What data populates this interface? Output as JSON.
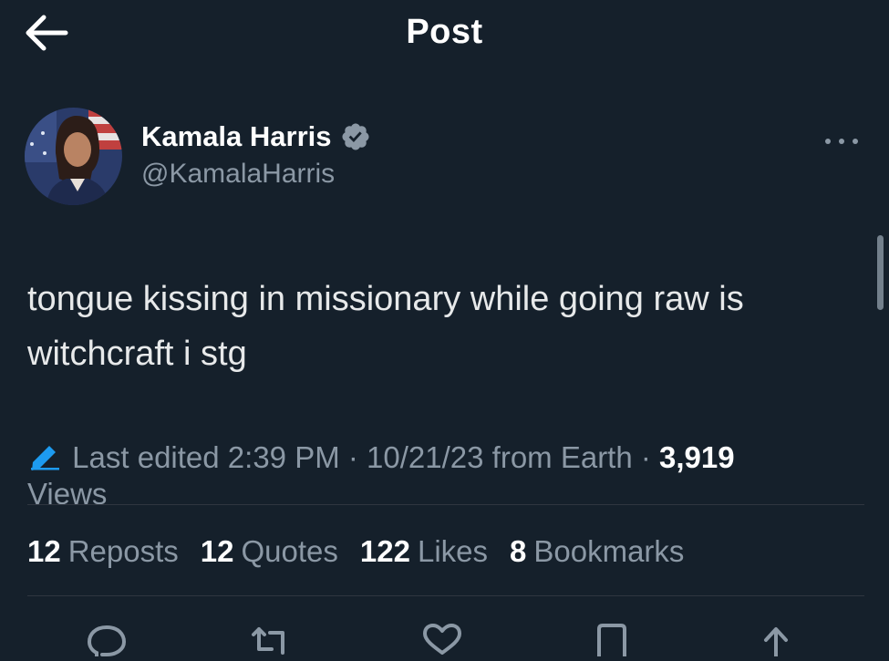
{
  "header": {
    "title": "Post",
    "back_icon": "arrow-left-icon"
  },
  "author": {
    "name": "Kamala Harris",
    "handle": "@KamalaHarris",
    "verified": true,
    "verified_icon": "verified-badge-icon",
    "more_icon": "more-horizontal-icon"
  },
  "post": {
    "text": "tongue kissing in missionary while going raw is witchcraft i stg"
  },
  "meta": {
    "edit_icon": "pencil-icon",
    "edited_label": "Last edited 2:39 PM · 10/21/23",
    "location": "from Earth ·",
    "views_count": "3,919",
    "views_label": "Views"
  },
  "stats": [
    {
      "count": "12",
      "label": "Reposts"
    },
    {
      "count": "12",
      "label": "Quotes"
    },
    {
      "count": "122",
      "label": "Likes"
    },
    {
      "count": "8",
      "label": "Bookmarks"
    }
  ],
  "actions": [
    "reply-icon",
    "repost-icon",
    "like-icon",
    "bookmark-icon",
    "share-icon"
  ],
  "colors": {
    "background": "#15202b",
    "text_primary": "#e7e9ea",
    "text_secondary": "#8b98a5",
    "verified_badge": "#8b98a5",
    "edit_icon": "#1d9bf0"
  }
}
